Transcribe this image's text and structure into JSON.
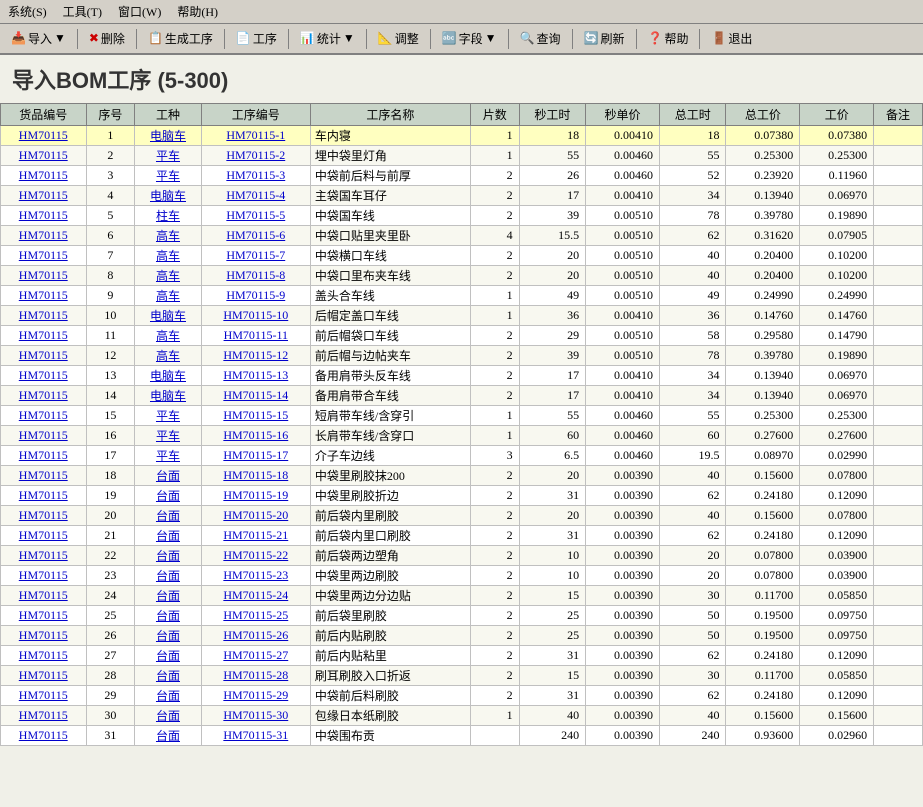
{
  "menubar": {
    "items": [
      {
        "label": "系统(S)"
      },
      {
        "label": "工具(T)"
      },
      {
        "label": "窗口(W)"
      },
      {
        "label": "帮助(H)"
      }
    ]
  },
  "toolbar": {
    "buttons": [
      {
        "label": "导入",
        "icon": "📥",
        "name": "import-button",
        "has_arrow": true
      },
      {
        "label": "删除",
        "icon": "✖",
        "name": "delete-button"
      },
      {
        "label": "生成工序",
        "icon": "📋",
        "name": "generate-button"
      },
      {
        "label": "工序",
        "icon": "📄",
        "name": "process-button"
      },
      {
        "label": "统计",
        "icon": "📊",
        "name": "statistics-button",
        "has_arrow": true
      },
      {
        "label": "调整",
        "icon": "📐",
        "name": "adjust-button"
      },
      {
        "label": "字段",
        "icon": "🔤",
        "name": "field-button",
        "has_arrow": true
      },
      {
        "label": "查询",
        "icon": "🔍",
        "name": "query-button"
      },
      {
        "label": "刷新",
        "icon": "🔄",
        "name": "refresh-button"
      },
      {
        "label": "帮助",
        "icon": "❓",
        "name": "help-button"
      },
      {
        "label": "退出",
        "icon": "🚪",
        "name": "exit-button"
      }
    ]
  },
  "page": {
    "title": "导入BOM工序 (5-300)"
  },
  "table": {
    "headers": [
      "货品编号",
      "序号",
      "工种",
      "工序编号",
      "工序名称",
      "片数",
      "秒工时",
      "秒单价",
      "总工时",
      "总工价",
      "工价",
      "备注"
    ],
    "rows": [
      {
        "id": "HM70115",
        "seq": "1",
        "type": "电脑车",
        "code": "HM70115-1",
        "name": "车内寝",
        "pieces": "1",
        "sec_time": "18",
        "sec_price": "0.00410",
        "total_time": "18",
        "total_price": "0.07380",
        "wage": "0.07380",
        "note": "",
        "highlight": true
      },
      {
        "id": "HM70115",
        "seq": "2",
        "type": "平车",
        "code": "HM70115-2",
        "name": "埋中袋里灯角",
        "pieces": "1",
        "sec_time": "55",
        "sec_price": "0.00460",
        "total_time": "55",
        "total_price": "0.25300",
        "wage": "0.25300",
        "note": ""
      },
      {
        "id": "HM70115",
        "seq": "3",
        "type": "平车",
        "code": "HM70115-3",
        "name": "中袋前后料与前厚",
        "pieces": "2",
        "sec_time": "26",
        "sec_price": "0.00460",
        "total_time": "52",
        "total_price": "0.23920",
        "wage": "0.11960",
        "note": ""
      },
      {
        "id": "HM70115",
        "seq": "4",
        "type": "电脑车",
        "code": "HM70115-4",
        "name": "主袋国车耳仔",
        "pieces": "2",
        "sec_time": "17",
        "sec_price": "0.00410",
        "total_time": "34",
        "total_price": "0.13940",
        "wage": "0.06970",
        "note": ""
      },
      {
        "id": "HM70115",
        "seq": "5",
        "type": "柱车",
        "code": "HM70115-5",
        "name": "中袋国车线",
        "pieces": "2",
        "sec_time": "39",
        "sec_price": "0.00510",
        "total_time": "78",
        "total_price": "0.39780",
        "wage": "0.19890",
        "note": ""
      },
      {
        "id": "HM70115",
        "seq": "6",
        "type": "高车",
        "code": "HM70115-6",
        "name": "中袋口贴里夹里卧",
        "pieces": "4",
        "sec_time": "15.5",
        "sec_price": "0.00510",
        "total_time": "62",
        "total_price": "0.31620",
        "wage": "0.07905",
        "note": ""
      },
      {
        "id": "HM70115",
        "seq": "7",
        "type": "高车",
        "code": "HM70115-7",
        "name": "中袋横口车线",
        "pieces": "2",
        "sec_time": "20",
        "sec_price": "0.00510",
        "total_time": "40",
        "total_price": "0.20400",
        "wage": "0.10200",
        "note": ""
      },
      {
        "id": "HM70115",
        "seq": "8",
        "type": "高车",
        "code": "HM70115-8",
        "name": "中袋口里布夹车线",
        "pieces": "2",
        "sec_time": "20",
        "sec_price": "0.00510",
        "total_time": "40",
        "total_price": "0.20400",
        "wage": "0.10200",
        "note": ""
      },
      {
        "id": "HM70115",
        "seq": "9",
        "type": "高车",
        "code": "HM70115-9",
        "name": "盖头合车线",
        "pieces": "1",
        "sec_time": "49",
        "sec_price": "0.00510",
        "total_time": "49",
        "total_price": "0.24990",
        "wage": "0.24990",
        "note": ""
      },
      {
        "id": "HM70115",
        "seq": "10",
        "type": "电脑车",
        "code": "HM70115-10",
        "name": "后帽定盖口车线",
        "pieces": "1",
        "sec_time": "36",
        "sec_price": "0.00410",
        "total_time": "36",
        "total_price": "0.14760",
        "wage": "0.14760",
        "note": ""
      },
      {
        "id": "HM70115",
        "seq": "11",
        "type": "高车",
        "code": "HM70115-11",
        "name": "前后帽袋口车线",
        "pieces": "2",
        "sec_time": "29",
        "sec_price": "0.00510",
        "total_time": "58",
        "total_price": "0.29580",
        "wage": "0.14790",
        "note": ""
      },
      {
        "id": "HM70115",
        "seq": "12",
        "type": "高车",
        "code": "HM70115-12",
        "name": "前后帽与边帖夹车",
        "pieces": "2",
        "sec_time": "39",
        "sec_price": "0.00510",
        "total_time": "78",
        "total_price": "0.39780",
        "wage": "0.19890",
        "note": ""
      },
      {
        "id": "HM70115",
        "seq": "13",
        "type": "电脑车",
        "code": "HM70115-13",
        "name": "备用肩带头反车线",
        "pieces": "2",
        "sec_time": "17",
        "sec_price": "0.00410",
        "total_time": "34",
        "total_price": "0.13940",
        "wage": "0.06970",
        "note": ""
      },
      {
        "id": "HM70115",
        "seq": "14",
        "type": "电脑车",
        "code": "HM70115-14",
        "name": "备用肩带合车线",
        "pieces": "2",
        "sec_time": "17",
        "sec_price": "0.00410",
        "total_time": "34",
        "total_price": "0.13940",
        "wage": "0.06970",
        "note": ""
      },
      {
        "id": "HM70115",
        "seq": "15",
        "type": "平车",
        "code": "HM70115-15",
        "name": "短肩带车线/含穿引",
        "pieces": "1",
        "sec_time": "55",
        "sec_price": "0.00460",
        "total_time": "55",
        "total_price": "0.25300",
        "wage": "0.25300",
        "note": ""
      },
      {
        "id": "HM70115",
        "seq": "16",
        "type": "平车",
        "code": "HM70115-16",
        "name": "长肩带车线/含穿口",
        "pieces": "1",
        "sec_time": "60",
        "sec_price": "0.00460",
        "total_time": "60",
        "total_price": "0.27600",
        "wage": "0.27600",
        "note": ""
      },
      {
        "id": "HM70115",
        "seq": "17",
        "type": "平车",
        "code": "HM70115-17",
        "name": "介子车边线",
        "pieces": "3",
        "sec_time": "6.5",
        "sec_price": "0.00460",
        "total_time": "19.5",
        "total_price": "0.08970",
        "wage": "0.02990",
        "note": ""
      },
      {
        "id": "HM70115",
        "seq": "18",
        "type": "台面",
        "code": "HM70115-18",
        "name": "中袋里刷胶抹200",
        "pieces": "2",
        "sec_time": "20",
        "sec_price": "0.00390",
        "total_time": "40",
        "total_price": "0.15600",
        "wage": "0.07800",
        "note": ""
      },
      {
        "id": "HM70115",
        "seq": "19",
        "type": "台面",
        "code": "HM70115-19",
        "name": "中袋里刷胶折边",
        "pieces": "2",
        "sec_time": "31",
        "sec_price": "0.00390",
        "total_time": "62",
        "total_price": "0.24180",
        "wage": "0.12090",
        "note": ""
      },
      {
        "id": "HM70115",
        "seq": "20",
        "type": "台面",
        "code": "HM70115-20",
        "name": "前后袋内里刷胶",
        "pieces": "2",
        "sec_time": "20",
        "sec_price": "0.00390",
        "total_time": "40",
        "total_price": "0.15600",
        "wage": "0.07800",
        "note": ""
      },
      {
        "id": "HM70115",
        "seq": "21",
        "type": "台面",
        "code": "HM70115-21",
        "name": "前后袋内里口刷胶",
        "pieces": "2",
        "sec_time": "31",
        "sec_price": "0.00390",
        "total_time": "62",
        "total_price": "0.24180",
        "wage": "0.12090",
        "note": ""
      },
      {
        "id": "HM70115",
        "seq": "22",
        "type": "台面",
        "code": "HM70115-22",
        "name": "前后袋两边塑角",
        "pieces": "2",
        "sec_time": "10",
        "sec_price": "0.00390",
        "total_time": "20",
        "total_price": "0.07800",
        "wage": "0.03900",
        "note": ""
      },
      {
        "id": "HM70115",
        "seq": "23",
        "type": "台面",
        "code": "HM70115-23",
        "name": "中袋里两边刷胶",
        "pieces": "2",
        "sec_time": "10",
        "sec_price": "0.00390",
        "total_time": "20",
        "total_price": "0.07800",
        "wage": "0.03900",
        "note": ""
      },
      {
        "id": "HM70115",
        "seq": "24",
        "type": "台面",
        "code": "HM70115-24",
        "name": "中袋里两边分边贴",
        "pieces": "2",
        "sec_time": "15",
        "sec_price": "0.00390",
        "total_time": "30",
        "total_price": "0.11700",
        "wage": "0.05850",
        "note": ""
      },
      {
        "id": "HM70115",
        "seq": "25",
        "type": "台面",
        "code": "HM70115-25",
        "name": "前后袋里刷胶",
        "pieces": "2",
        "sec_time": "25",
        "sec_price": "0.00390",
        "total_time": "50",
        "total_price": "0.19500",
        "wage": "0.09750",
        "note": ""
      },
      {
        "id": "HM70115",
        "seq": "26",
        "type": "台面",
        "code": "HM70115-26",
        "name": "前后内贴刷胶",
        "pieces": "2",
        "sec_time": "25",
        "sec_price": "0.00390",
        "total_time": "50",
        "total_price": "0.19500",
        "wage": "0.09750",
        "note": ""
      },
      {
        "id": "HM70115",
        "seq": "27",
        "type": "台面",
        "code": "HM70115-27",
        "name": "前后内贴粘里",
        "pieces": "2",
        "sec_time": "31",
        "sec_price": "0.00390",
        "total_time": "62",
        "total_price": "0.24180",
        "wage": "0.12090",
        "note": ""
      },
      {
        "id": "HM70115",
        "seq": "28",
        "type": "台面",
        "code": "HM70115-28",
        "name": "刷耳刷胶入口折返",
        "pieces": "2",
        "sec_time": "15",
        "sec_price": "0.00390",
        "total_time": "30",
        "total_price": "0.11700",
        "wage": "0.05850",
        "note": ""
      },
      {
        "id": "HM70115",
        "seq": "29",
        "type": "台面",
        "code": "HM70115-29",
        "name": "中袋前后料刷胶",
        "pieces": "2",
        "sec_time": "31",
        "sec_price": "0.00390",
        "total_time": "62",
        "total_price": "0.24180",
        "wage": "0.12090",
        "note": ""
      },
      {
        "id": "HM70115",
        "seq": "30",
        "type": "台面",
        "code": "HM70115-30",
        "name": "包缘日本纸刷胶",
        "pieces": "1",
        "sec_time": "40",
        "sec_price": "0.00390",
        "total_time": "40",
        "total_price": "0.15600",
        "wage": "0.15600",
        "note": ""
      },
      {
        "id": "HM70115",
        "seq": "31",
        "type": "台面",
        "code": "HM70115-31",
        "name": "中袋围布贡",
        "pieces": "",
        "sec_time": "240",
        "sec_price": "0.00390",
        "total_time": "240",
        "total_price": "0.93600",
        "wage": "0.02960",
        "note": ""
      }
    ]
  }
}
